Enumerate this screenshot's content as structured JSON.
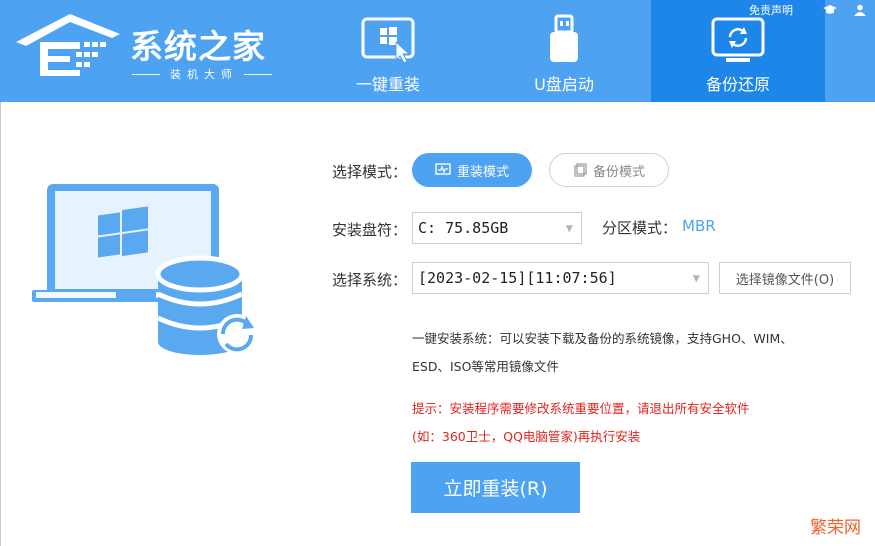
{
  "header": {
    "logo_title": "系统之家",
    "logo_subtitle": "装机大师",
    "top_links": {
      "disclaimer": "免责声明"
    },
    "tabs": [
      {
        "label": "一键重装",
        "icon": "windows-cursor-icon",
        "active": false
      },
      {
        "label": "U盘启动",
        "icon": "usb-drive-icon",
        "active": false
      },
      {
        "label": "备份还原",
        "icon": "backup-restore-icon",
        "active": true
      }
    ]
  },
  "form": {
    "mode_label": "选择模式：",
    "mode_reinstall": "重装模式",
    "mode_backup": "备份模式",
    "disk_label": "安装盘符：",
    "disk_value": "C: 75.85GB",
    "partition_label": "分区模式：",
    "partition_value": "MBR",
    "system_label": "选择系统：",
    "system_value": "[2023-02-15][11:07:56]",
    "choose_image_button": "选择镜像文件(O)"
  },
  "info": {
    "line1": "一键安装系统：可以安装下载及备份的系统镜像，支持GHO、WIM、",
    "line2": "ESD、ISO等常用镜像文件"
  },
  "warning": {
    "line1": "提示：安装程序需要修改系统重要位置，请退出所有安全软件",
    "line2": "(如：360卫士，QQ电脑管家)再执行安装"
  },
  "primary_button": "立即重装(R)",
  "watermark": "繁荣网",
  "colors": {
    "accent": "#4da2f2",
    "active_tab": "#1e86e8",
    "warning": "#e0231d"
  }
}
